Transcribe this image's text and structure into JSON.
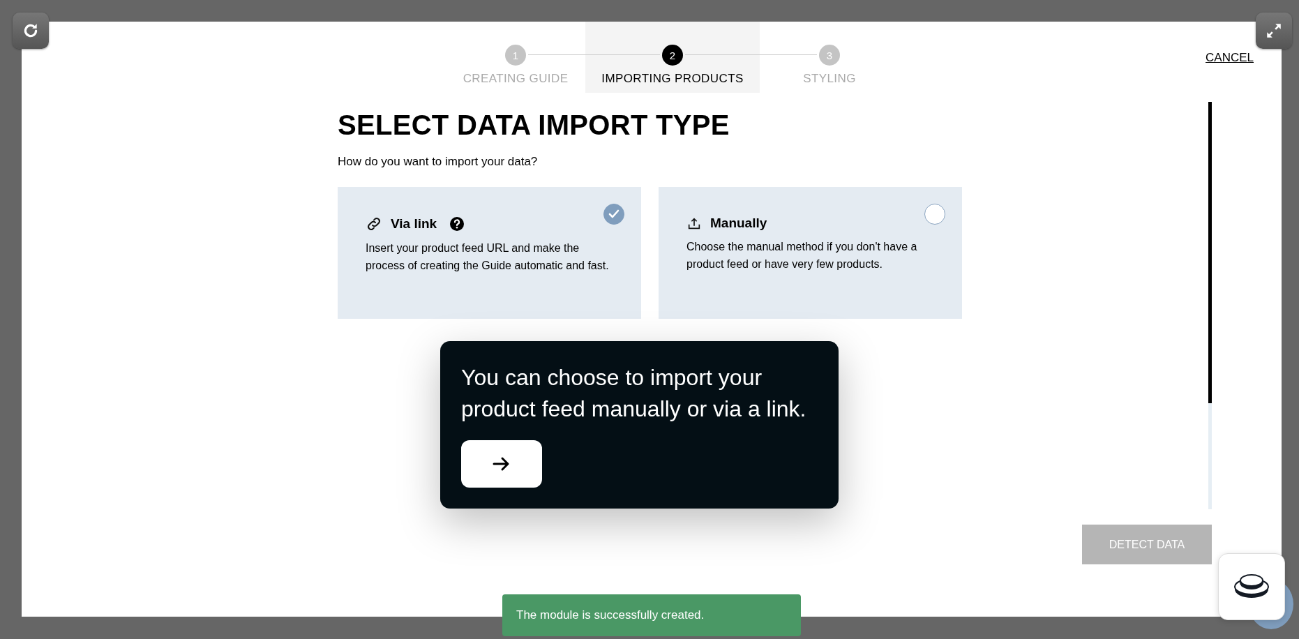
{
  "steps": [
    {
      "number": "1",
      "label": "CREATING GUIDE",
      "selected": false
    },
    {
      "number": "2",
      "label": "IMPORTING PRODUCTS",
      "selected": true
    },
    {
      "number": "3",
      "label": "STYLING",
      "selected": false
    }
  ],
  "cancel": "CANCEL",
  "heading": "SELECT DATA IMPORT TYPE",
  "subtitle": "How do you want to import your data?",
  "options": [
    {
      "kind": "link",
      "title": "Via link",
      "help": true,
      "description": "Insert your product feed URL and make the process of creating the Guide automatic and fast.",
      "selected": true
    },
    {
      "kind": "upload",
      "title": "Manually",
      "help": false,
      "description": "Choose the manual method if you don't have a product feed or have very few products.",
      "selected": false
    }
  ],
  "tooltip": {
    "text": "You can choose to import your product feed manually or via a link."
  },
  "detect_button": {
    "label": "DETECT DATA",
    "disabled": true
  },
  "toast": {
    "text": "The module is successfully created."
  }
}
